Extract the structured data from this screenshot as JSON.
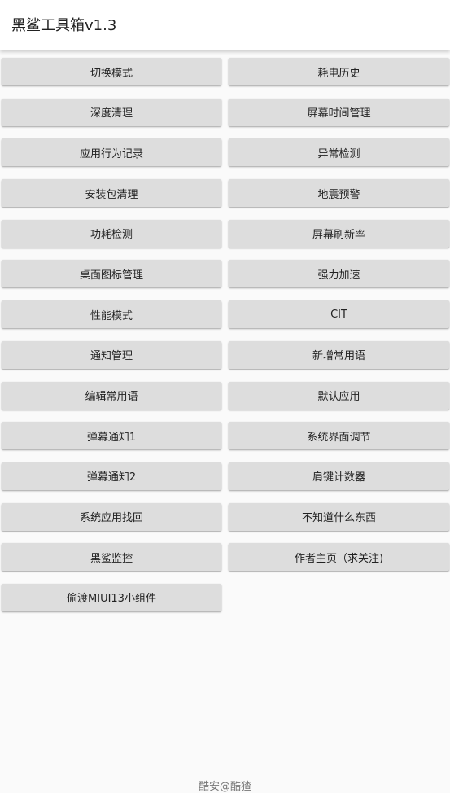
{
  "app": {
    "title": "黑鲨工具箱v1.3"
  },
  "buttons": [
    [
      "切换模式",
      "耗电历史"
    ],
    [
      "深度清理",
      "屏幕时间管理"
    ],
    [
      "应用行为记录",
      "异常检测"
    ],
    [
      "安装包清理",
      "地震预警"
    ],
    [
      "功耗检测",
      "屏幕刷新率"
    ],
    [
      "桌面图标管理",
      "强力加速"
    ],
    [
      "性能模式",
      "CIT"
    ],
    [
      "通知管理",
      "新增常用语"
    ],
    [
      "编辑常用语",
      "默认应用"
    ],
    [
      "弹幕通知1",
      "系统界面调节"
    ],
    [
      "弹幕通知2",
      "肩键计数器"
    ],
    [
      "系统应用找回",
      "不知道什么东西"
    ],
    [
      "黑鲨监控",
      "作者主页（求关注)"
    ],
    [
      "偷渡MIUI13小组件"
    ]
  ],
  "footer": {
    "text": "酷安@酷猹"
  }
}
